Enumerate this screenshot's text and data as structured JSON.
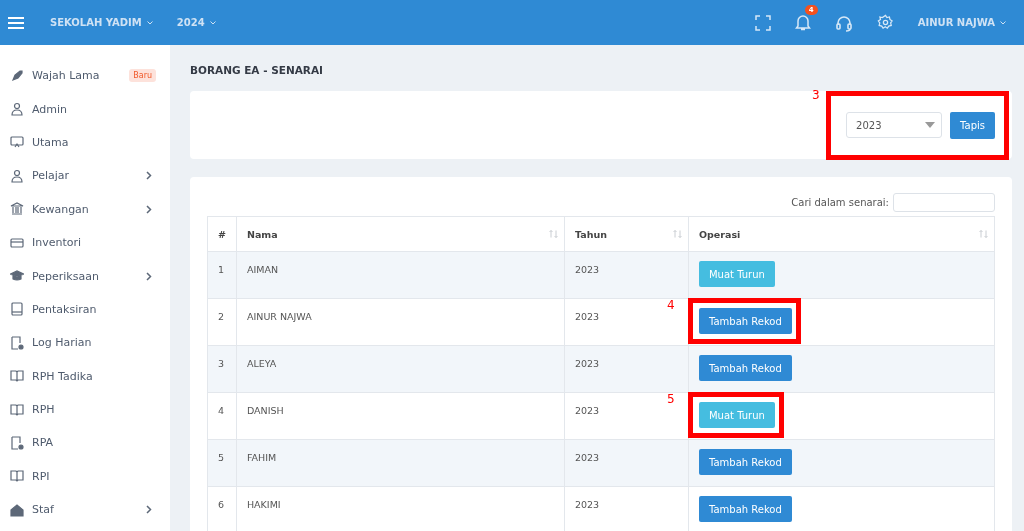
{
  "topbar": {
    "school": "SEKOLAH YADIM",
    "year": "2024",
    "notification_count": "4",
    "user": "AINUR NAJWA"
  },
  "sidebar": {
    "items": [
      {
        "label": "Wajah Lama",
        "badge": "Baru",
        "has_children": false
      },
      {
        "label": "Admin",
        "has_children": false
      },
      {
        "label": "Utama",
        "has_children": false
      },
      {
        "label": "Pelajar",
        "has_children": true
      },
      {
        "label": "Kewangan",
        "has_children": true
      },
      {
        "label": "Inventori",
        "has_children": false
      },
      {
        "label": "Peperiksaan",
        "has_children": true
      },
      {
        "label": "Pentaksiran",
        "has_children": false
      },
      {
        "label": "Log Harian",
        "has_children": false
      },
      {
        "label": "RPH Tadika",
        "has_children": false
      },
      {
        "label": "RPH",
        "has_children": false
      },
      {
        "label": "RPA",
        "has_children": false
      },
      {
        "label": "RPI",
        "has_children": false
      },
      {
        "label": "Staf",
        "has_children": true
      }
    ]
  },
  "page_title": "BORANG EA - SENARAI",
  "filter": {
    "year_select": "2023",
    "button": "Tapis",
    "annotation": "3"
  },
  "table": {
    "search_label": "Cari dalam senarai:",
    "columns": [
      {
        "label": "#",
        "sortable": false
      },
      {
        "label": "Nama",
        "sortable": true
      },
      {
        "label": "Tahun",
        "sortable": true
      },
      {
        "label": "Operasi",
        "sortable": true
      }
    ],
    "rows": [
      {
        "no": "1",
        "name": "AIMAN",
        "year": "2023",
        "action": {
          "kind": "download",
          "label": "Muat Turun"
        }
      },
      {
        "no": "2",
        "name": "AINUR NAJWA",
        "year": "2023",
        "action": {
          "kind": "add",
          "label": "Tambah Rekod"
        },
        "annotation": "4"
      },
      {
        "no": "3",
        "name": "ALEYA",
        "year": "2023",
        "action": {
          "kind": "add",
          "label": "Tambah Rekod"
        }
      },
      {
        "no": "4",
        "name": "DANISH",
        "year": "2023",
        "action": {
          "kind": "download",
          "label": "Muat Turun"
        },
        "annotation": "5"
      },
      {
        "no": "5",
        "name": "FAHIM",
        "year": "2023",
        "action": {
          "kind": "add",
          "label": "Tambah Rekod"
        }
      },
      {
        "no": "6",
        "name": "HAKIMI",
        "year": "2023",
        "action": {
          "kind": "add",
          "label": "Tambah Rekod"
        }
      }
    ]
  }
}
